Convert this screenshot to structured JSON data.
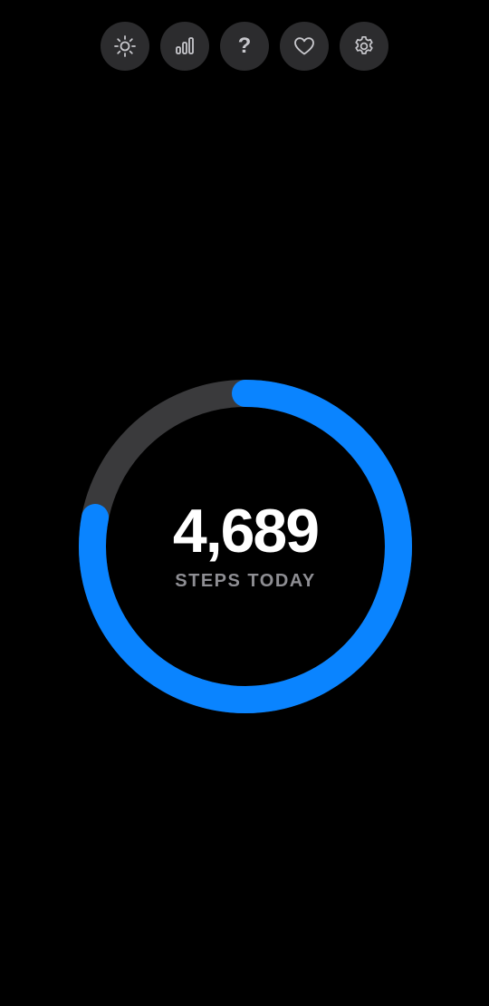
{
  "toolbar": {
    "buttons": [
      {
        "icon": "sun-icon"
      },
      {
        "icon": "bar-chart-icon"
      },
      {
        "icon": "help-icon",
        "glyph": "?"
      },
      {
        "icon": "heart-icon"
      },
      {
        "icon": "gear-icon"
      }
    ]
  },
  "steps": {
    "count": "4,689",
    "label": "STEPS TODAY",
    "progress_fraction": 0.78
  },
  "colors": {
    "background": "#000000",
    "button_bg": "#2c2c2e",
    "icon": "#c7c7cc",
    "ring_track": "#3a3a3c",
    "ring_progress": "#0a84ff",
    "count_text": "#ffffff",
    "label_text": "#8e8e93"
  }
}
